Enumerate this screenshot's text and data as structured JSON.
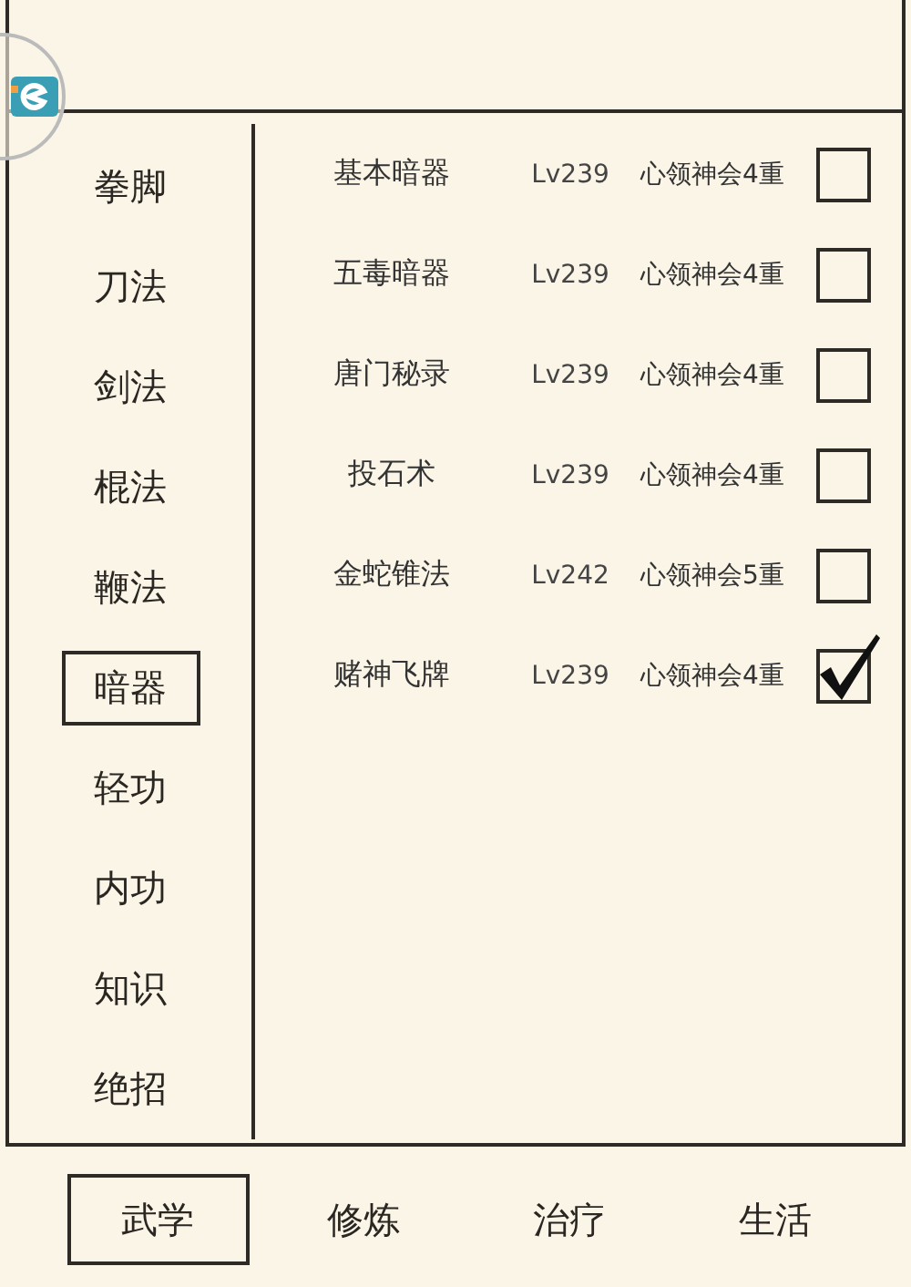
{
  "categories": [
    {
      "label": "拳脚",
      "selected": false
    },
    {
      "label": "刀法",
      "selected": false
    },
    {
      "label": "剑法",
      "selected": false
    },
    {
      "label": "棍法",
      "selected": false
    },
    {
      "label": "鞭法",
      "selected": false
    },
    {
      "label": "暗器",
      "selected": true
    },
    {
      "label": "轻功",
      "selected": false
    },
    {
      "label": "内功",
      "selected": false
    },
    {
      "label": "知识",
      "selected": false
    },
    {
      "label": "绝招",
      "selected": false
    }
  ],
  "skills": [
    {
      "name": "基本暗器",
      "level": "Lv239",
      "mastery": "心领神会4重",
      "checked": false
    },
    {
      "name": "五毒暗器",
      "level": "Lv239",
      "mastery": "心领神会4重",
      "checked": false
    },
    {
      "name": "唐门秘录",
      "level": "Lv239",
      "mastery": "心领神会4重",
      "checked": false
    },
    {
      "name": "投石术",
      "level": "Lv239",
      "mastery": "心领神会4重",
      "checked": false
    },
    {
      "name": "金蛇锥法",
      "level": "Lv242",
      "mastery": "心领神会5重",
      "checked": false
    },
    {
      "name": "赌神飞牌",
      "level": "Lv239",
      "mastery": "心领神会4重",
      "checked": true
    }
  ],
  "tabs": [
    {
      "label": "武学",
      "selected": true
    },
    {
      "label": "修炼",
      "selected": false
    },
    {
      "label": "治疗",
      "selected": false
    },
    {
      "label": "生活",
      "selected": false
    }
  ]
}
